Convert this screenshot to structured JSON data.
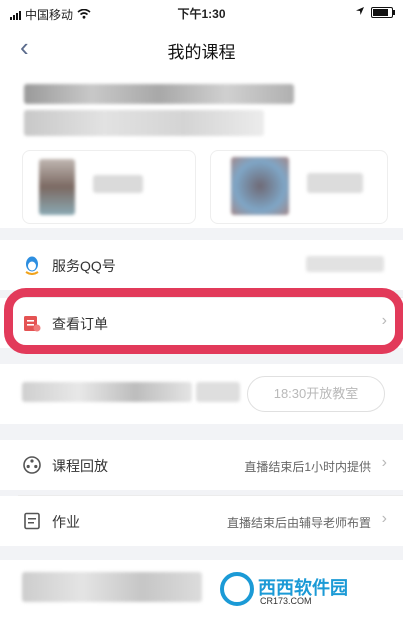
{
  "status_bar": {
    "carrier": "中国移动",
    "time": "下午1:30"
  },
  "navbar": {
    "back_icon": "chevron-left-icon",
    "title": "我的课程"
  },
  "service_qq": {
    "label": "服务QQ号",
    "icon": "qq-penguin-icon"
  },
  "orders": {
    "label": "查看订单",
    "icon": "order-icon"
  },
  "live": {
    "open_button": "18:30开放教室"
  },
  "replay": {
    "label": "课程回放",
    "value": "直播结束后1小时内提供",
    "icon": "film-reel-icon"
  },
  "homework": {
    "label": "作业",
    "value": "直播结束后由辅导老师布置",
    "icon": "document-icon"
  },
  "watermark": {
    "text": "西西软件园",
    "url": "CR173.COM"
  },
  "colors": {
    "highlight": "#e23a5a",
    "accent": "#1b9ad6"
  }
}
